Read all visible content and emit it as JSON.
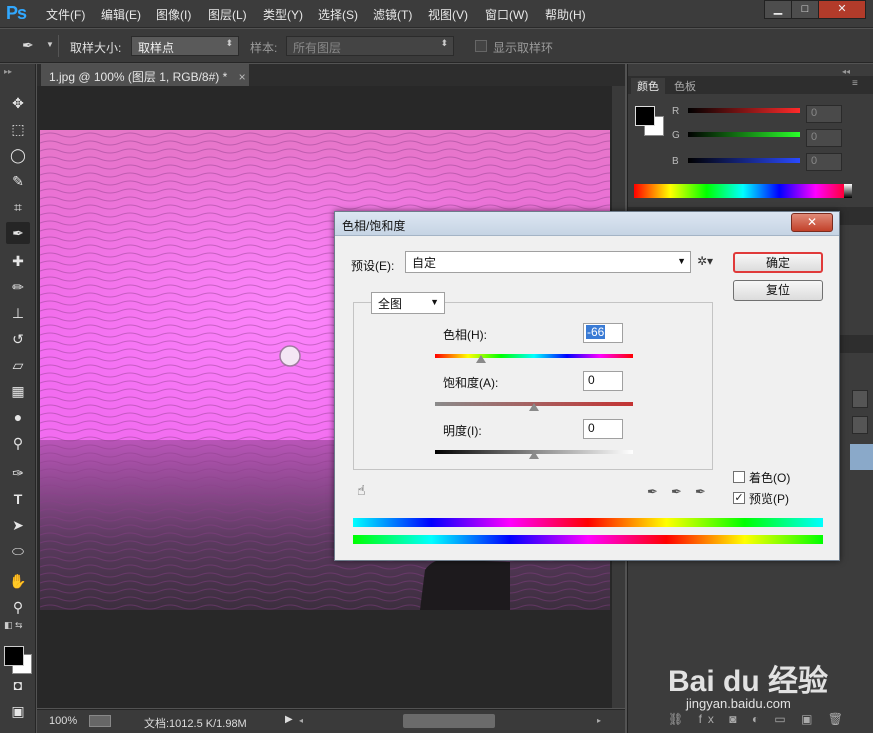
{
  "app": {
    "logo": "Ps"
  },
  "menu": [
    "文件(F)",
    "编辑(E)",
    "图像(I)",
    "图层(L)",
    "类型(Y)",
    "选择(S)",
    "滤镜(T)",
    "视图(V)",
    "窗口(W)",
    "帮助(H)"
  ],
  "window_controls": {
    "minimize": "▁",
    "restore": "□",
    "close": "✕"
  },
  "options": {
    "sample_size_label": "取样大小:",
    "sample_size_value": "取样点",
    "sample_label": "样本:",
    "sample_value": "所有图层",
    "show_ring_label": "显示取样环"
  },
  "document": {
    "tab_title": "1.jpg @ 100% (图层 1, RGB/8#) *",
    "tab_close": "×"
  },
  "status": {
    "zoom": "100%",
    "doc_info": "文档:1012.5 K/1.98M"
  },
  "color_panel": {
    "tabs": [
      "颜色",
      "色板"
    ],
    "channels": [
      {
        "name": "R",
        "value": "0",
        "color": "#ff2a2a"
      },
      {
        "name": "G",
        "value": "0",
        "color": "#2aff2a"
      },
      {
        "name": "B",
        "value": "0",
        "color": "#2a4aff"
      }
    ]
  },
  "dialog": {
    "title": "色相/饱和度",
    "preset_label": "预设(E):",
    "preset_value": "自定",
    "channel_value": "全图",
    "ok_label": "确定",
    "reset_label": "复位",
    "hue_label": "色相(H):",
    "hue_value": "-66",
    "saturation_label": "饱和度(A):",
    "saturation_value": "0",
    "lightness_label": "明度(I):",
    "lightness_value": "0",
    "colorize_label": "着色(O)",
    "colorize_checked": false,
    "preview_label": "预览(P)",
    "preview_checked": true,
    "preview_mark": "✓"
  },
  "watermark": {
    "brand": "Bai du 经验",
    "url": "jingyan.baidu.com"
  }
}
